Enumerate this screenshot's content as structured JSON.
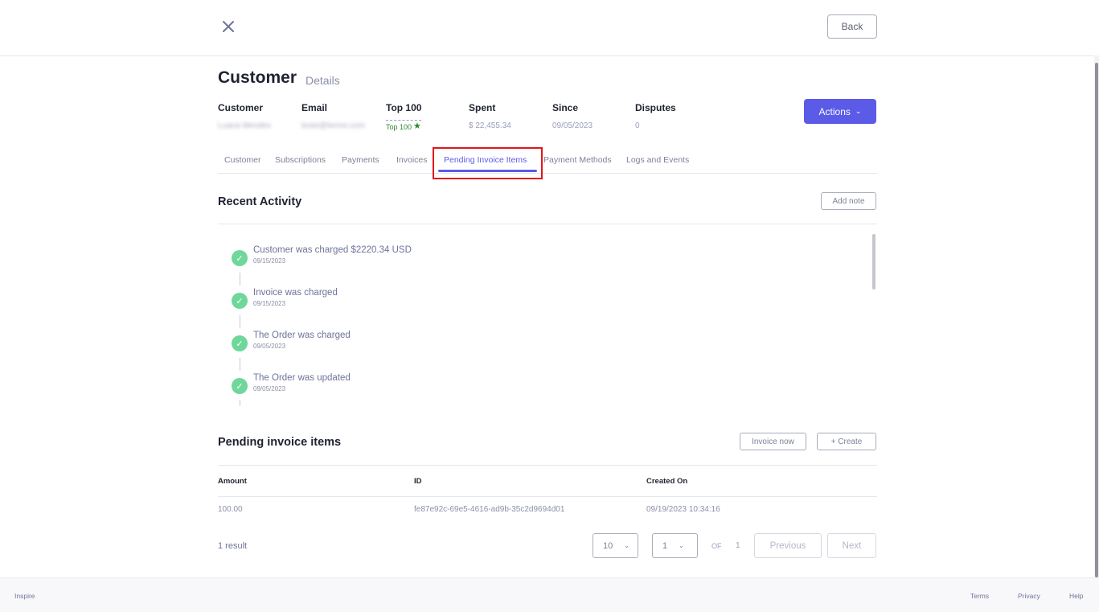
{
  "header": {
    "back_label": "Back"
  },
  "page": {
    "title": "Customer",
    "subtitle": "Details"
  },
  "summary": {
    "customer": {
      "label": "Customer",
      "value": "Luana Mendes"
    },
    "email": {
      "label": "Email",
      "value": "teste@termo.com"
    },
    "top100": {
      "label": "Top 100",
      "value": "Top 100"
    },
    "spent": {
      "label": "Spent",
      "value": "$ 22,455.34"
    },
    "since": {
      "label": "Since",
      "value": "09/05/2023"
    },
    "disputes": {
      "label": "Disputes",
      "value": "0"
    }
  },
  "actions_label": "Actions",
  "tabs": [
    {
      "label": "Customer",
      "active": false
    },
    {
      "label": "Subscriptions",
      "active": false
    },
    {
      "label": "Payments",
      "active": false
    },
    {
      "label": "Invoices",
      "active": false
    },
    {
      "label": "Pending Invoice Items",
      "active": true
    },
    {
      "label": "Payment Methods",
      "active": false
    },
    {
      "label": "Logs and Events",
      "active": false
    }
  ],
  "recent_activity": {
    "title": "Recent Activity",
    "add_note_label": "Add note",
    "items": [
      {
        "title": "Customer was charged $2220.34 USD",
        "date": "09/15/2023"
      },
      {
        "title": "Invoice was charged",
        "date": "09/15/2023"
      },
      {
        "title": "The Order was charged",
        "date": "09/05/2023"
      },
      {
        "title": "The Order was updated",
        "date": "09/05/2023"
      }
    ]
  },
  "pending_items": {
    "title": "Pending invoice items",
    "invoice_now_label": "Invoice now",
    "create_label": "+ Create",
    "columns": [
      "Amount",
      "ID",
      "Created On"
    ],
    "rows": [
      {
        "amount": "100.00",
        "id": "fe87e92c-69e5-4616-ad9b-35c2d9694d01",
        "created_on": "09/19/2023 10:34:16"
      }
    ]
  },
  "pagination": {
    "result_count": "1 result",
    "page_size": "10",
    "current_page": "1",
    "of_label": "OF",
    "total_pages": "1",
    "previous_label": "Previous",
    "next_label": "Next"
  },
  "footer": {
    "brand": "Inspire",
    "links": [
      "Terms",
      "Privacy",
      "Help"
    ]
  },
  "colors": {
    "accent": "#5b5be8",
    "highlight": "#e0171b",
    "success": "#6fd79a",
    "top100_green": "#2a8a2a"
  },
  "icons": {
    "close": "close-icon",
    "chevron": "chevron-down-icon",
    "check": "check-icon",
    "star": "star-icon"
  }
}
